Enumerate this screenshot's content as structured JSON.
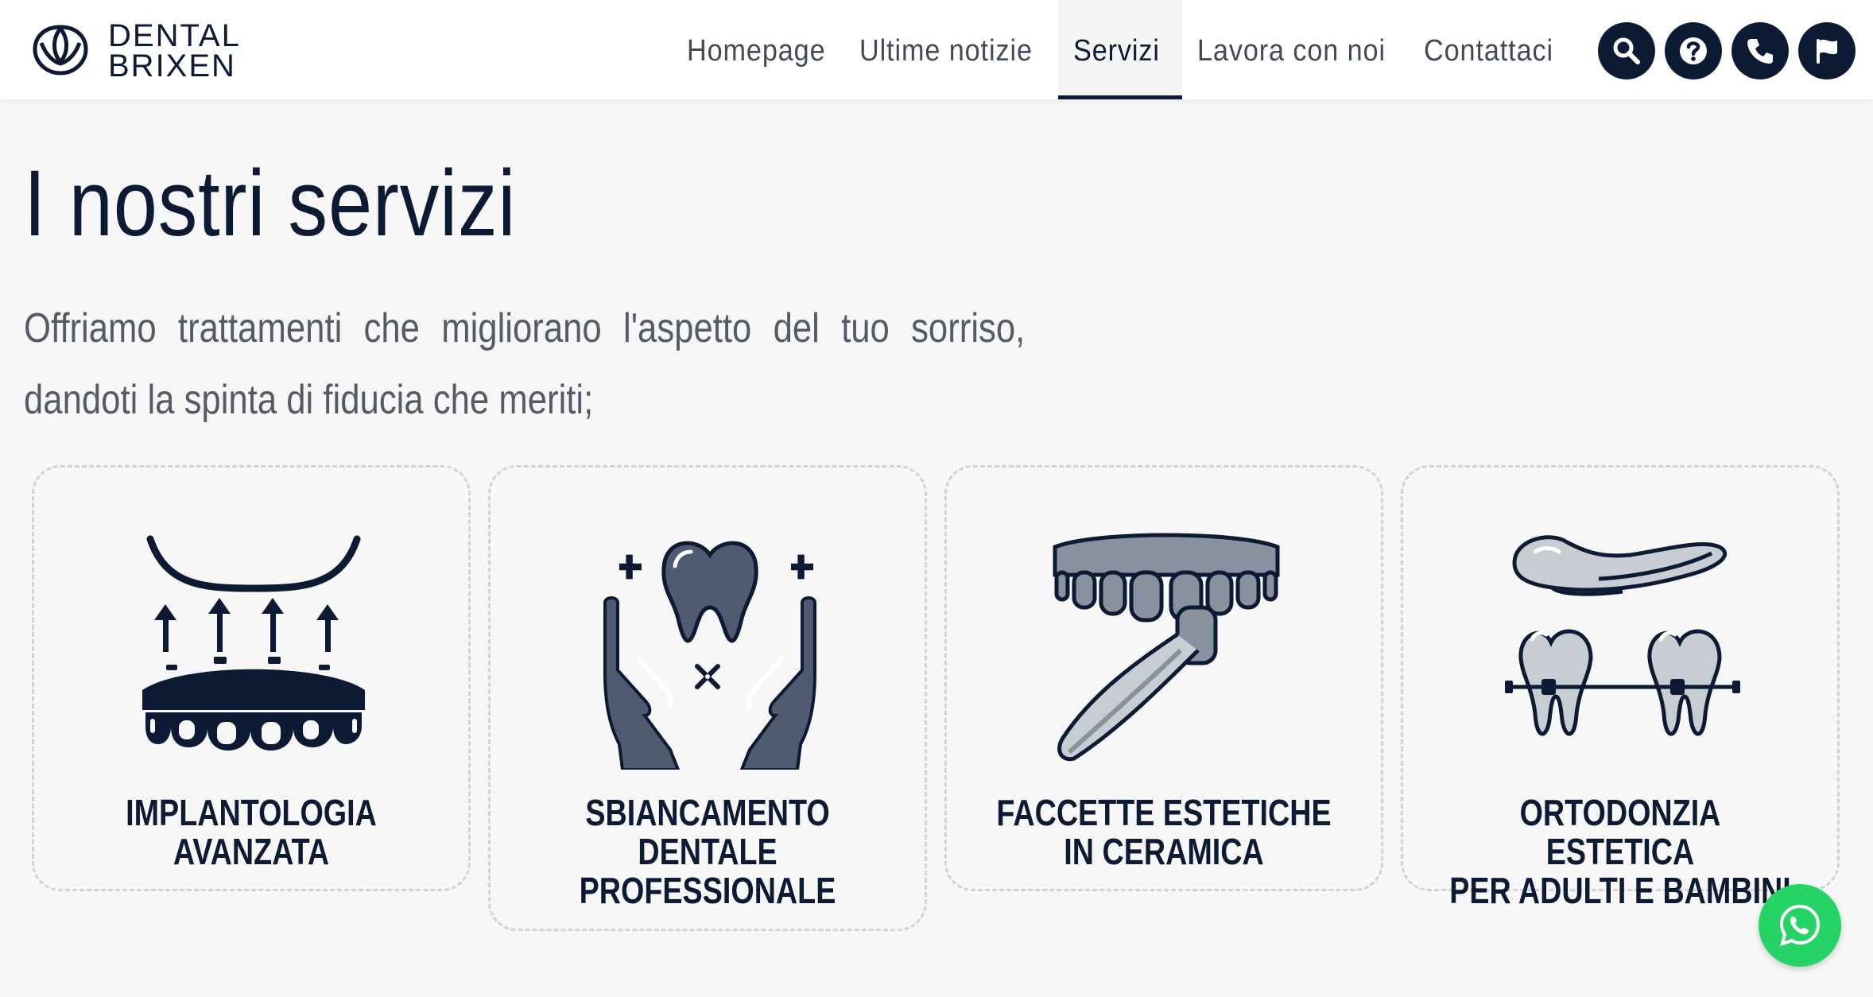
{
  "brand": {
    "line1": "DENTAL",
    "line2": "BRIXEN",
    "logo_icon": "tooth-lotus-icon"
  },
  "nav": {
    "items": [
      {
        "label": "Homepage",
        "active": false
      },
      {
        "label": "Ultime notizie",
        "active": false
      },
      {
        "label": "Servizi",
        "active": true
      },
      {
        "label": "Lavora con noi",
        "active": false
      },
      {
        "label": "Contattaci",
        "active": false
      }
    ],
    "icon_buttons": [
      "search-icon",
      "help-icon",
      "phone-icon",
      "flag-icon"
    ]
  },
  "page": {
    "title": "I nostri servizi",
    "intro_line1": "Offriamo trattamenti che migliorano l'aspetto del tuo sorriso,",
    "intro_line2": "dandoti la spinta di fiducia che meriti;"
  },
  "services": [
    {
      "line1": "IMPLANTOLOGIA",
      "line2": "AVANZATA",
      "line3": "",
      "icon": "dental-implant-icon"
    },
    {
      "line1": "SBIANCAMENTO",
      "line2": "DENTALE",
      "line3": "PROFESSIONALE",
      "icon": "tooth-whitening-icon"
    },
    {
      "line1": "FACCETTE ESTETICHE",
      "line2": "IN CERAMICA",
      "line3": "",
      "icon": "dental-veneer-icon"
    },
    {
      "line1": "ORTODONZIA ESTETICA",
      "line2": "PER ADULTI E BAMBINI",
      "line3": "",
      "icon": "orthodontic-aligner-icon"
    }
  ],
  "colors": {
    "navy": "#0c1a33",
    "slate": "#4f5b70",
    "light_gray": "#c8ccd3",
    "whatsapp_green": "#25d366",
    "background": "#f7f7f7"
  },
  "whatsapp": {
    "icon": "whatsapp-icon"
  }
}
